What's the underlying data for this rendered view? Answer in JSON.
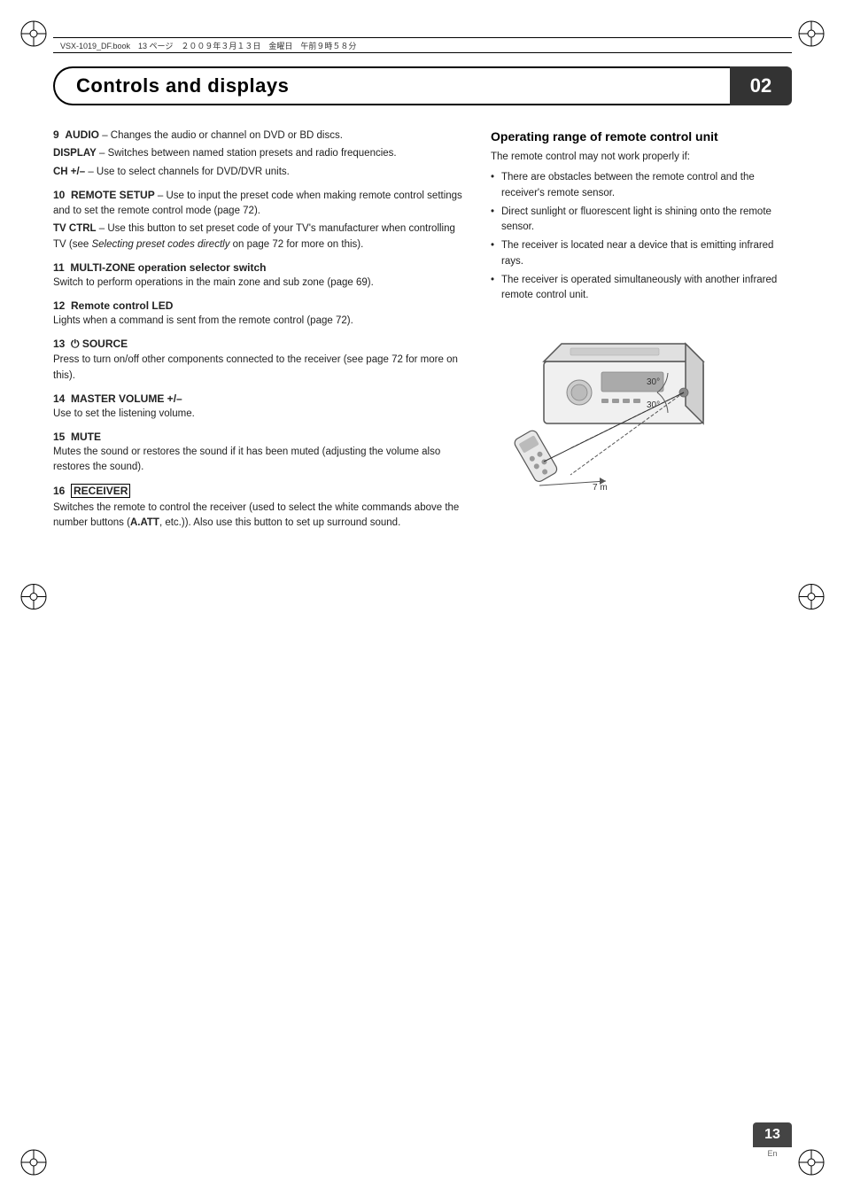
{
  "topbar": {
    "text": "VSX-1019_DF.book　13 ページ　２００９年３月１３日　金曜日　午前９時５８分"
  },
  "header": {
    "title": "Controls and displays",
    "chapter_number": "02"
  },
  "left_column": {
    "items": [
      {
        "number": "9",
        "labels": [
          {
            "text": "AUDIO",
            "style": "bold"
          },
          {
            "text": " – Changes the audio or channel on DVD or BD discs."
          }
        ],
        "sub_items": [
          {
            "label": "DISPLAY",
            "label_style": "bold",
            "desc": " – Switches between named station presets and radio frequencies."
          },
          {
            "label": "CH +/–",
            "label_style": "bold",
            "desc": " – Use to select channels for DVD/DVR units."
          }
        ]
      },
      {
        "number": "10",
        "labels": [
          {
            "text": "REMOTE SETUP",
            "style": "bold"
          },
          {
            "text": " – Use to input the preset code when making remote control settings and to set the remote control mode (page 72)."
          }
        ],
        "sub_items": [
          {
            "label": "TV CTRL",
            "label_style": "bold",
            "desc": " – Use this button to set preset code of your TV's manufacturer when controlling TV (see ",
            "desc_italic": "Selecting preset codes directly",
            "desc_after": " on page 72 for more on this)."
          }
        ]
      },
      {
        "number": "11",
        "labels": [
          {
            "text": "MULTI-ZONE operation selector switch",
            "style": "bold"
          }
        ],
        "desc": "Switch to perform operations in the main zone and sub zone (page 69)."
      },
      {
        "number": "12",
        "labels": [
          {
            "text": "Remote control LED",
            "style": "bold"
          }
        ],
        "desc": "Lights when a command is sent from the remote control (page 72)."
      },
      {
        "number": "13",
        "labels": [
          {
            "text": "⏻ SOURCE",
            "style": "bold"
          }
        ],
        "desc": "Press to turn on/off other components connected to the receiver (see page 72 for more on this)."
      },
      {
        "number": "14",
        "labels": [
          {
            "text": "MASTER VOLUME +/–",
            "style": "bold"
          }
        ],
        "desc": "Use to set the listening volume."
      },
      {
        "number": "15",
        "labels": [
          {
            "text": "MUTE",
            "style": "bold"
          }
        ],
        "desc": "Mutes the sound or restores the sound if it has been muted (adjusting the volume also restores the sound)."
      },
      {
        "number": "16",
        "labels": [
          {
            "text": "RECEIVER",
            "style": "bold-box"
          }
        ],
        "desc": "Switches the remote to control the receiver (used to select the white commands above the number buttons (",
        "desc_bold": "A.ATT",
        "desc_after": ", etc.)). Also use this button to set up surround sound."
      }
    ]
  },
  "right_column": {
    "section_title": "Operating range of remote control unit",
    "intro": "The remote control may not work properly if:",
    "bullets": [
      "There are obstacles between the remote control and the receiver's remote sensor.",
      "Direct sunlight or fluorescent light is shining onto the remote sensor.",
      "The receiver is located near a device that is emitting infrared rays.",
      "The receiver is operated simultaneously with another infrared remote control unit."
    ],
    "diagram": {
      "angle1": "30°",
      "angle2": "30°",
      "distance": "7 m"
    }
  },
  "page": {
    "number": "13",
    "lang": "En"
  }
}
